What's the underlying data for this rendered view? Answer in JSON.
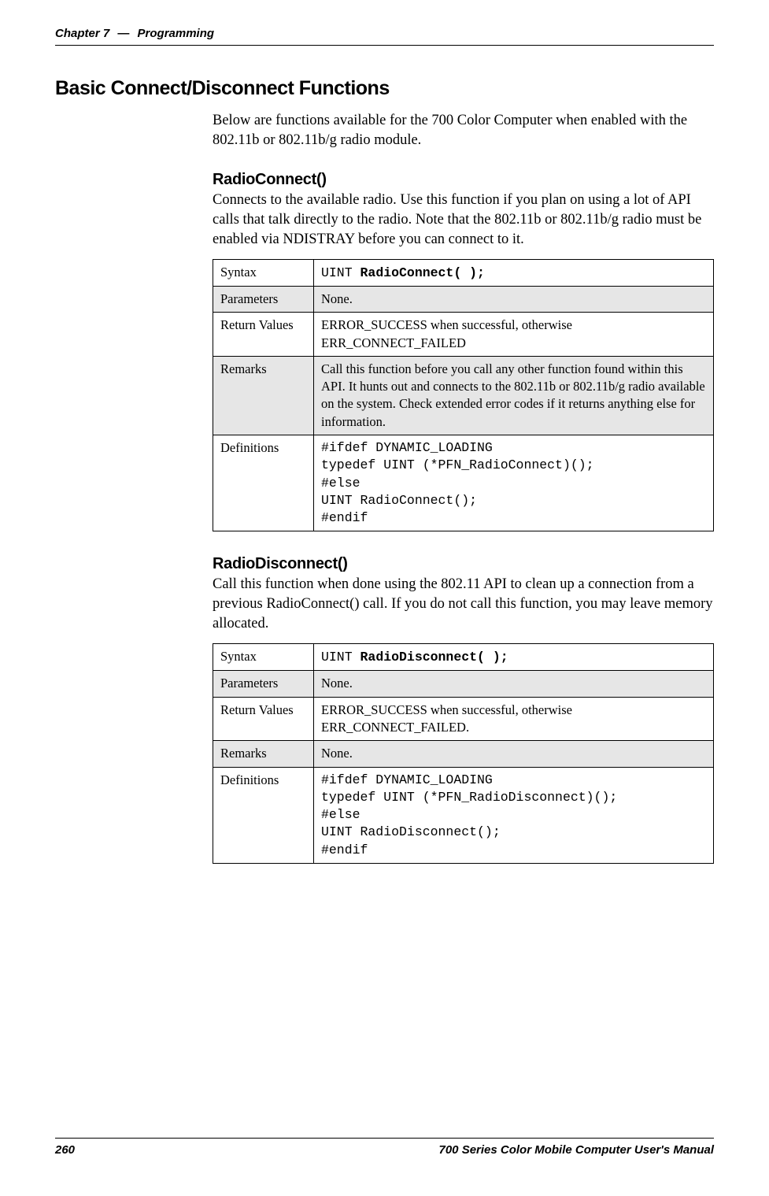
{
  "header": {
    "chapter": "Chapter 7",
    "dash": "—",
    "title": "Programming"
  },
  "section": {
    "title": "Basic Connect/Disconnect Functions",
    "intro": "Below are functions available for the 700 Color Computer when enabled with the 802.11b or 802.11b/g radio module."
  },
  "radioConnect": {
    "title": "RadioConnect()",
    "body": "Connects to the available radio. Use this function if you plan on using a lot of API calls that talk directly to the radio. Note that the 802.11b or 802.11b/g radio must be enabled via NDISTRAY before you can connect to it.",
    "table": {
      "syntaxLabel": "Syntax",
      "syntaxPrefix": "UINT ",
      "syntaxBold": "RadioConnect( );",
      "parametersLabel": "Parameters",
      "parametersValue": "None.",
      "returnLabel": "Return Values",
      "returnValue": "ERROR_SUCCESS when successful, otherwise ERR_CONNECT_FAILED",
      "remarksLabel": "Remarks",
      "remarksValue": "Call this function before you call any other function found within this API. It hunts out and connects to the 802.11b or 802.11b/g radio available on the system. Check extended error codes if it returns anything else for information.",
      "definitionsLabel": "Definitions",
      "definitionsCode": "#ifdef DYNAMIC_LOADING\ntypedef UINT (*PFN_RadioConnect)();\n#else\nUINT RadioConnect();\n#endif"
    }
  },
  "radioDisconnect": {
    "title": "RadioDisconnect()",
    "body": "Call this function when done using the 802.11 API to clean up a connection from a previous RadioConnect() call. If you do not call this function, you may leave memory allocated.",
    "table": {
      "syntaxLabel": "Syntax",
      "syntaxPrefix": "UINT ",
      "syntaxBold": "RadioDisconnect( );",
      "parametersLabel": "Parameters",
      "parametersValue": "None.",
      "returnLabel": "Return Values",
      "returnValue": "ERROR_SUCCESS when successful, otherwise ERR_CONNECT_FAILED.",
      "remarksLabel": "Remarks",
      "remarksValue": "None.",
      "definitionsLabel": "Definitions",
      "definitionsCode": "#ifdef DYNAMIC_LOADING\ntypedef UINT (*PFN_RadioDisconnect)();\n#else\nUINT RadioDisconnect();\n#endif"
    }
  },
  "footer": {
    "pageNum": "260",
    "manual": "700 Series Color Mobile Computer User's Manual"
  }
}
